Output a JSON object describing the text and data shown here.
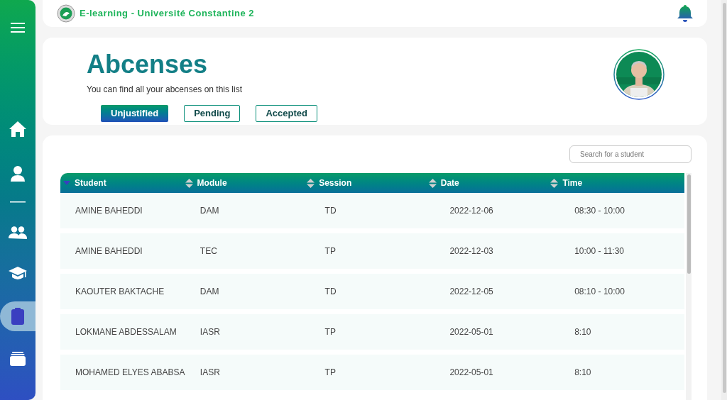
{
  "sidebar": {
    "items": [
      {
        "kind": "menu",
        "selected": false
      },
      {
        "kind": "home",
        "selected": false
      },
      {
        "kind": "user",
        "selected": false
      },
      {
        "kind": "divider"
      },
      {
        "kind": "group",
        "selected": false
      },
      {
        "kind": "graduation",
        "selected": false
      },
      {
        "kind": "clipboard",
        "selected": true
      },
      {
        "kind": "stack",
        "selected": false
      }
    ]
  },
  "header": {
    "title": "E-learning - Université Constantine 2"
  },
  "page": {
    "title": "Abcenses",
    "subtitle": "You can find all your abcenses on this list",
    "tabs": [
      {
        "label": "Unjustified",
        "selected": true
      },
      {
        "label": "Pending",
        "selected": false
      },
      {
        "label": "Accepted",
        "selected": false
      }
    ]
  },
  "search": {
    "placeholder": "Search for a student"
  },
  "table": {
    "columns": [
      {
        "label": "Student",
        "sorted": true
      },
      {
        "label": "Module",
        "sorted": false
      },
      {
        "label": "Session",
        "sorted": false
      },
      {
        "label": "Date",
        "sorted": false
      },
      {
        "label": "Time",
        "sorted": false
      }
    ],
    "rows": [
      [
        "AMINE BAHEDDI",
        "DAM",
        "TD",
        "2022-12-06",
        "08:30 - 10:00"
      ],
      [
        "AMINE BAHEDDI",
        "TEC",
        "TP",
        "2022-12-03",
        "10:00 - 11:30"
      ],
      [
        "KAOUTER BAKTACHE",
        "DAM",
        "TD",
        "2022-12-05",
        "08:10 - 10:00"
      ],
      [
        "LOKMANE ABDESSALAM",
        "IASR",
        "TP",
        "2022-05-01",
        "8:10"
      ],
      [
        "MOHAMED ELYES ABABSA",
        "IASR",
        "TP",
        "2022-05-01",
        "8:10"
      ]
    ]
  }
}
